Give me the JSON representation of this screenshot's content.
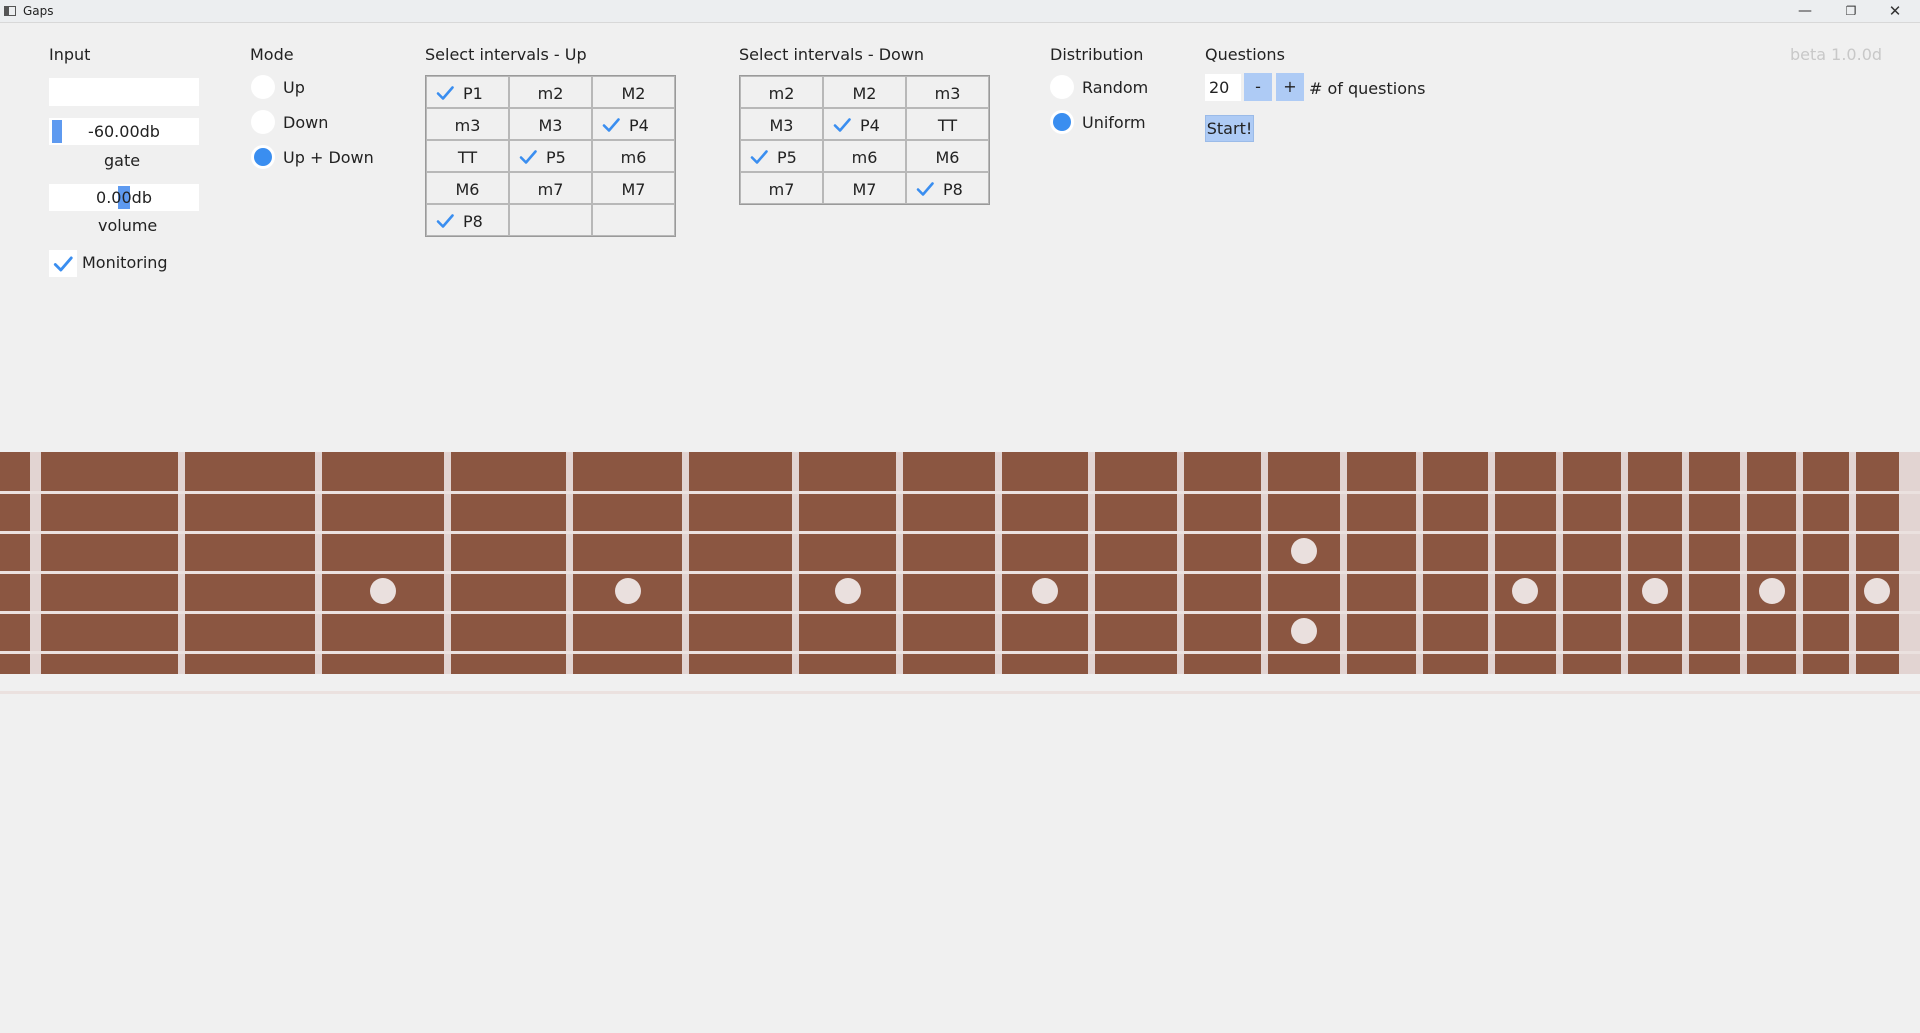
{
  "window": {
    "title": "Gaps",
    "icons": [
      "app-icon",
      "minimize-icon",
      "maximize-icon",
      "close-icon"
    ],
    "minimize_glyph": "—",
    "maximize_glyph": "❐",
    "close_glyph": "✕"
  },
  "version": "beta 1.0.0d",
  "input": {
    "heading": "Input",
    "input_value": "",
    "gate_value": "-60.00db",
    "gate_level": 0.05,
    "gate_label": "gate",
    "volume_value": "0.00db",
    "volume_level": 0.5,
    "volume_label": "volume",
    "monitoring_label": "Monitoring",
    "monitoring_checked": true
  },
  "mode": {
    "heading": "Mode",
    "options": [
      {
        "label": "Up",
        "selected": false
      },
      {
        "label": "Down",
        "selected": false
      },
      {
        "label": "Up + Down",
        "selected": true
      }
    ]
  },
  "intervals_up": {
    "heading": "Select intervals - Up",
    "cells": [
      {
        "label": "P1",
        "checked": true
      },
      {
        "label": "m2",
        "checked": false
      },
      {
        "label": "M2",
        "checked": false
      },
      {
        "label": "m3",
        "checked": false
      },
      {
        "label": "M3",
        "checked": false
      },
      {
        "label": "P4",
        "checked": true
      },
      {
        "label": "TT",
        "checked": false
      },
      {
        "label": "P5",
        "checked": true
      },
      {
        "label": "m6",
        "checked": false
      },
      {
        "label": "M6",
        "checked": false
      },
      {
        "label": "m7",
        "checked": false
      },
      {
        "label": "M7",
        "checked": false
      },
      {
        "label": "P8",
        "checked": true
      },
      {
        "label": "",
        "checked": false
      },
      {
        "label": "",
        "checked": false
      }
    ]
  },
  "intervals_down": {
    "heading": "Select intervals - Down",
    "cells": [
      {
        "label": "m2",
        "checked": false
      },
      {
        "label": "M2",
        "checked": false
      },
      {
        "label": "m3",
        "checked": false
      },
      {
        "label": "M3",
        "checked": false
      },
      {
        "label": "P4",
        "checked": true
      },
      {
        "label": "TT",
        "checked": false
      },
      {
        "label": "P5",
        "checked": true
      },
      {
        "label": "m6",
        "checked": false
      },
      {
        "label": "M6",
        "checked": false
      },
      {
        "label": "m7",
        "checked": false
      },
      {
        "label": "M7",
        "checked": false
      },
      {
        "label": "P8",
        "checked": true
      }
    ]
  },
  "distribution": {
    "heading": "Distribution",
    "options": [
      {
        "label": "Random",
        "selected": false
      },
      {
        "label": "Uniform",
        "selected": true
      }
    ]
  },
  "questions": {
    "heading": "Questions",
    "count": "20",
    "minus_label": "-",
    "plus_label": "+",
    "count_label": "# of questions",
    "start_label": "Start!"
  },
  "fretboard": {
    "strings": 6,
    "frets": 22,
    "single_marker_frets": [
      3,
      5,
      7,
      9,
      15,
      17,
      19,
      21
    ],
    "double_marker_frets": [
      12
    ],
    "colors": {
      "wood": "#8b5641",
      "fret": "#e2d4d2",
      "string": "#ebe1df",
      "marker": "#eae0de"
    }
  }
}
